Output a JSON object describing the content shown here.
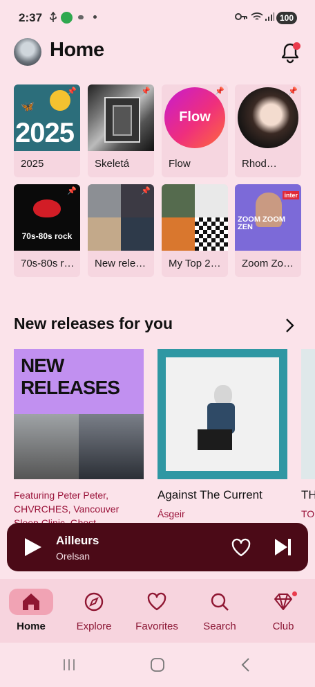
{
  "status_bar": {
    "time": "2:37",
    "battery": "100"
  },
  "header": {
    "title": "Home"
  },
  "quick_tiles": [
    {
      "label": "2025",
      "art_text": "2025"
    },
    {
      "label": "Skeletá",
      "art_text": ""
    },
    {
      "label": "Flow",
      "art_text": "Flow"
    },
    {
      "label": "Rhod…",
      "art_text": ""
    },
    {
      "label": "70s-80s r…",
      "art_text": "70s-80s rock"
    },
    {
      "label": "New rele…",
      "art_text": ""
    },
    {
      "label": "My Top 2…",
      "art_text": ""
    },
    {
      "label": "Zoom Zo…",
      "art_text": "ZOOM ZOOM ZEN",
      "badge": "inter"
    }
  ],
  "section": {
    "title": "New releases for you"
  },
  "release_cards": [
    {
      "cover_text": "NEW RELEASES",
      "subtitle": "Featuring Peter Peter, CHVRCHES, Vancouver Sleep Clinic, Ghost"
    },
    {
      "title": "Against The Current",
      "artist": "Ásgeir"
    },
    {
      "title": "TH",
      "artist": "TO"
    }
  ],
  "player": {
    "title": "Ailleurs",
    "artist": "Orelsan"
  },
  "nav": [
    {
      "label": "Home"
    },
    {
      "label": "Explore"
    },
    {
      "label": "Favorites"
    },
    {
      "label": "Search"
    },
    {
      "label": "Club"
    }
  ],
  "colors": {
    "accent": "#9a1239",
    "player_bg": "#4b0a17",
    "page_bg": "#fbe3ea"
  }
}
